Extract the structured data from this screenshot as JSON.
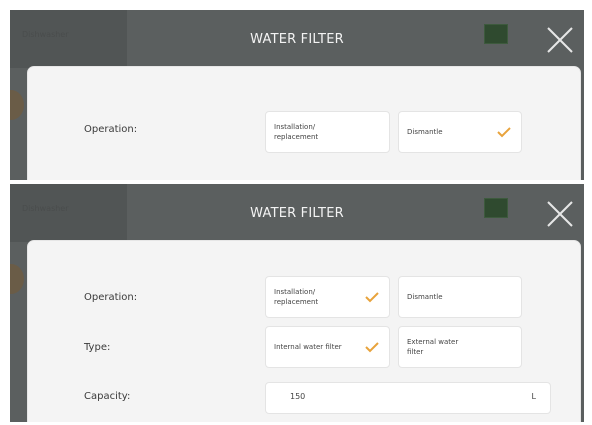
{
  "colors": {
    "accent": "#e8a33c",
    "panel": "#5b5f5f",
    "card": "#f4f4f4"
  },
  "screens": [
    {
      "sidebar_tab_label": "Dishwasher",
      "title": "WATER FILTER",
      "close_icon": "close-icon",
      "operation": {
        "label": "Operation:",
        "options": [
          "Installation/\nreplacement",
          "Dismantle"
        ],
        "selected": "Dismantle"
      }
    },
    {
      "sidebar_tab_label": "Dishwasher",
      "title": "WATER FILTER",
      "close_icon": "close-icon",
      "operation": {
        "label": "Operation:",
        "options": [
          "Installation/\nreplacement",
          "Dismantle"
        ],
        "selected": "Installation/\nreplacement"
      },
      "type": {
        "label": "Type:",
        "options": [
          "Internal water filter",
          "External water\nfilter"
        ],
        "selected": "Internal water filter"
      },
      "capacity": {
        "label": "Capacity:",
        "value": "150",
        "unit": "L"
      }
    }
  ]
}
